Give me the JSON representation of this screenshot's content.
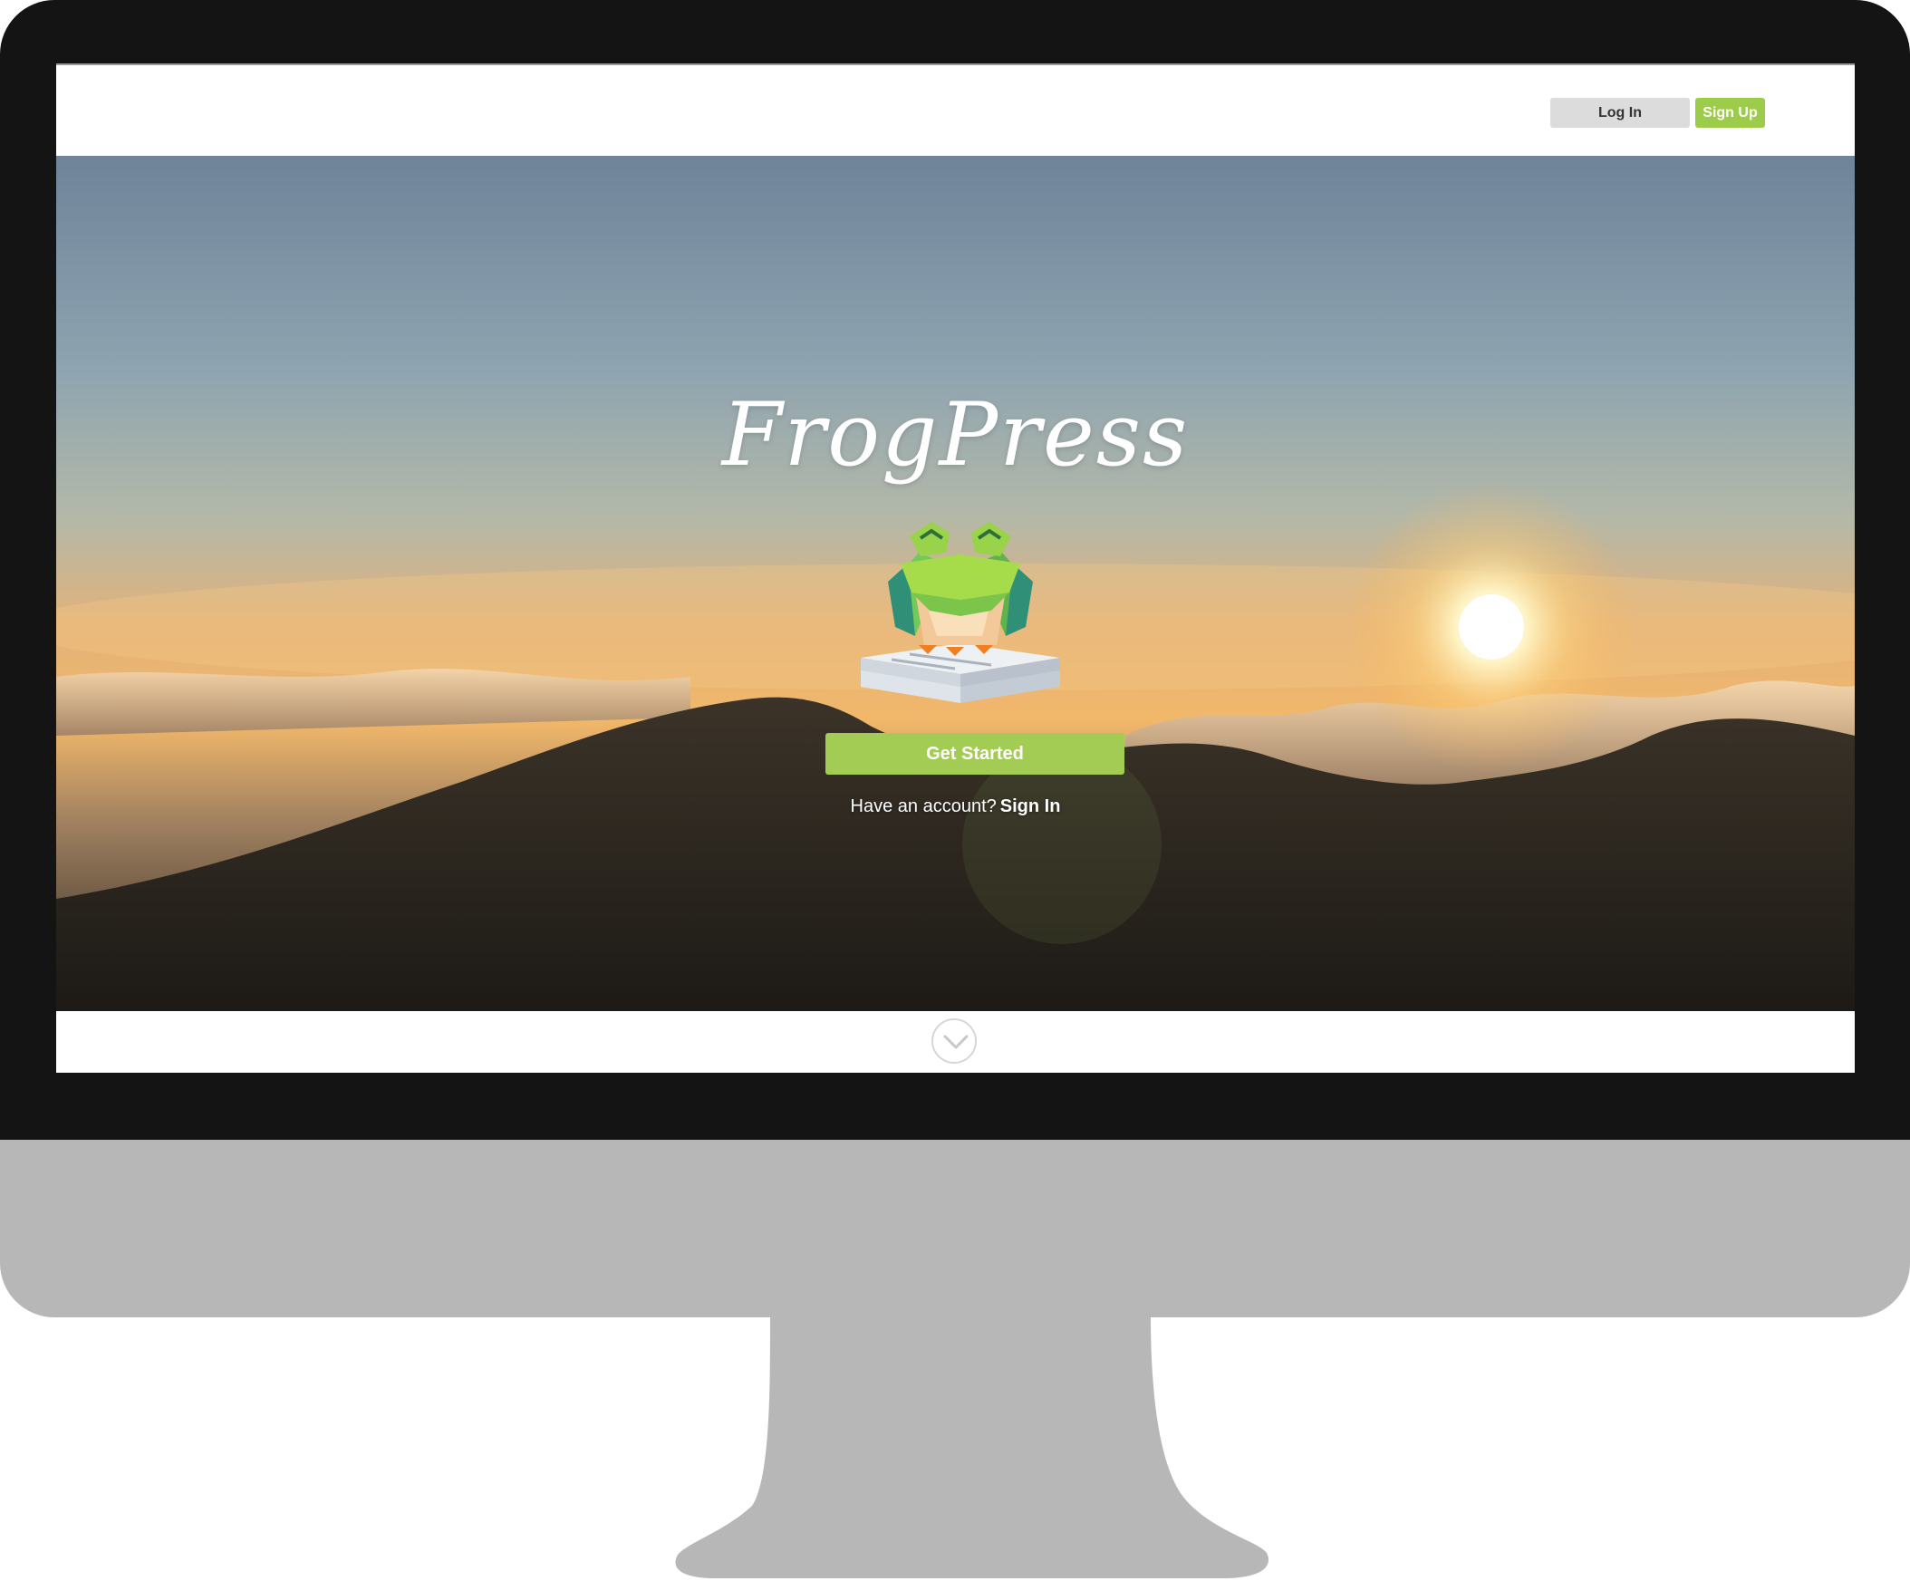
{
  "header": {
    "login_label": "Log In",
    "signup_label": "Sign Up"
  },
  "hero": {
    "logo_text": "FrogPress",
    "cta_label": "Get Started",
    "account_prompt": "Have an account?",
    "signin_label": "Sign In"
  },
  "icons": {
    "scroll": "chevron-down-icon",
    "logo": "frog-on-newspapers-icon"
  },
  "colors": {
    "accent_green": "#9ccc4a",
    "login_gray": "#dcdcdc",
    "bezel": "#141414",
    "stand": "#b7b7b7"
  }
}
